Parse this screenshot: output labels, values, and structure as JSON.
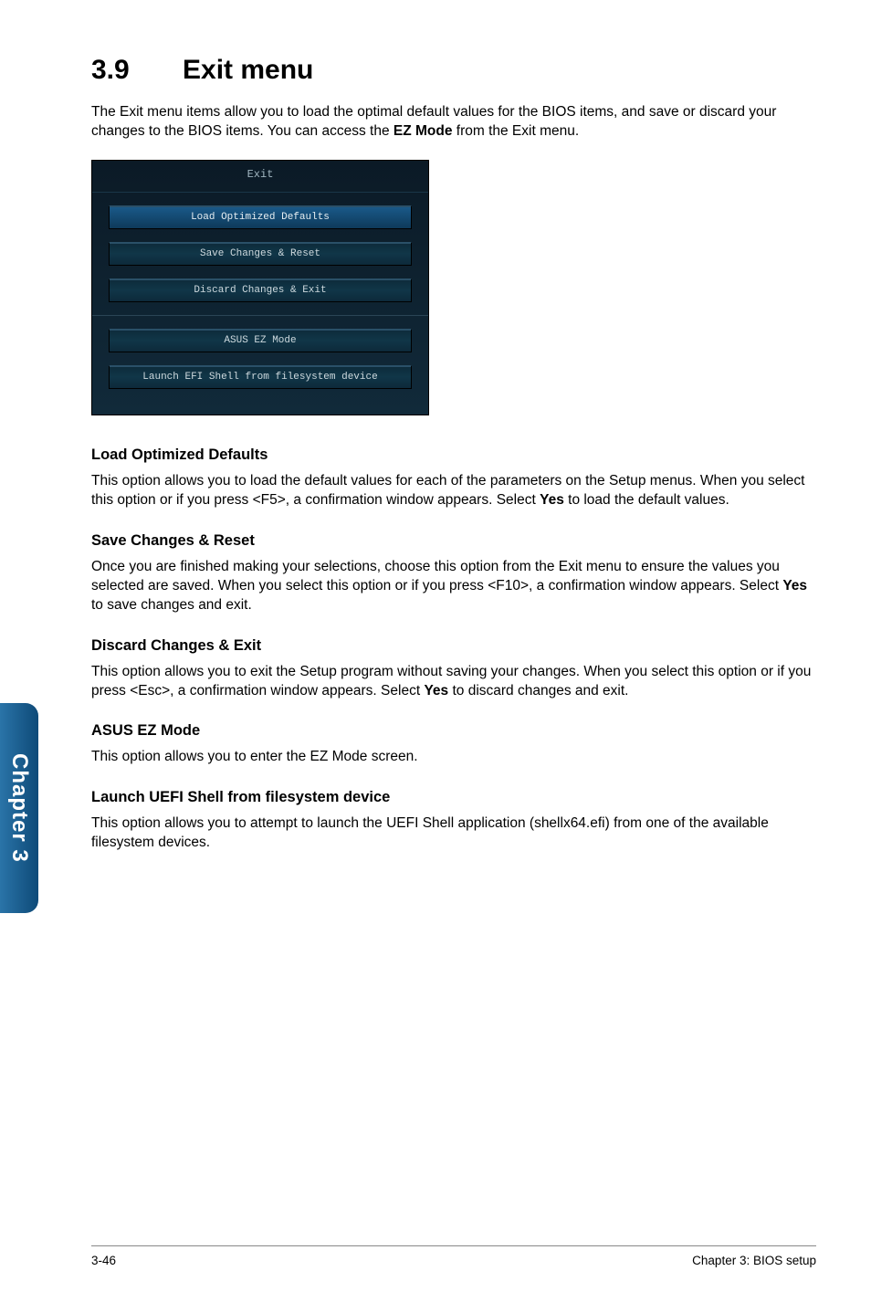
{
  "section": {
    "number": "3.9",
    "title": "Exit menu",
    "intro_a": "The Exit menu items allow you to load the optimal default values for the BIOS items, and save or discard your changes to the BIOS items. You can access the ",
    "intro_bold": "EZ Mode",
    "intro_b": " from the Exit menu."
  },
  "bios": {
    "header": "Exit",
    "buttons": {
      "load": "Load Optimized Defaults",
      "save": "Save Changes & Reset",
      "discard": "Discard Changes & Exit",
      "ezmode": "ASUS EZ Mode",
      "launch": "Launch EFI Shell from filesystem device"
    }
  },
  "blocks": {
    "load": {
      "heading": "Load Optimized Defaults",
      "text_a": "This option allows you to load the default values for each of the parameters on the Setup menus. When you select this option or if you press <F5>, a confirmation window appears. Select ",
      "yes": "Yes",
      "text_b": " to load the default values."
    },
    "save": {
      "heading": "Save Changes & Reset",
      "text_a": "Once you are finished making your selections, choose this option from the Exit menu to ensure the values you selected are saved. When you select this option or if you press <F10>, a confirmation window appears. Select ",
      "yes": "Yes",
      "text_b": " to save changes and exit."
    },
    "discard": {
      "heading": "Discard Changes & Exit",
      "text_a": "This option allows you to exit the Setup program without saving your changes. When you select this option or if you press <Esc>, a confirmation window appears. Select ",
      "yes": "Yes",
      "text_b": " to discard changes and exit."
    },
    "ez": {
      "heading": "ASUS EZ Mode",
      "text": "This option allows you to enter the EZ Mode screen."
    },
    "launch": {
      "heading": "Launch UEFI Shell from filesystem device",
      "text": "This option allows you to attempt to launch the UEFI Shell application (shellx64.efi) from one of the available filesystem devices."
    }
  },
  "sidetab": "Chapter 3",
  "footer": {
    "left": "3-46",
    "right": "Chapter 3: BIOS setup"
  }
}
